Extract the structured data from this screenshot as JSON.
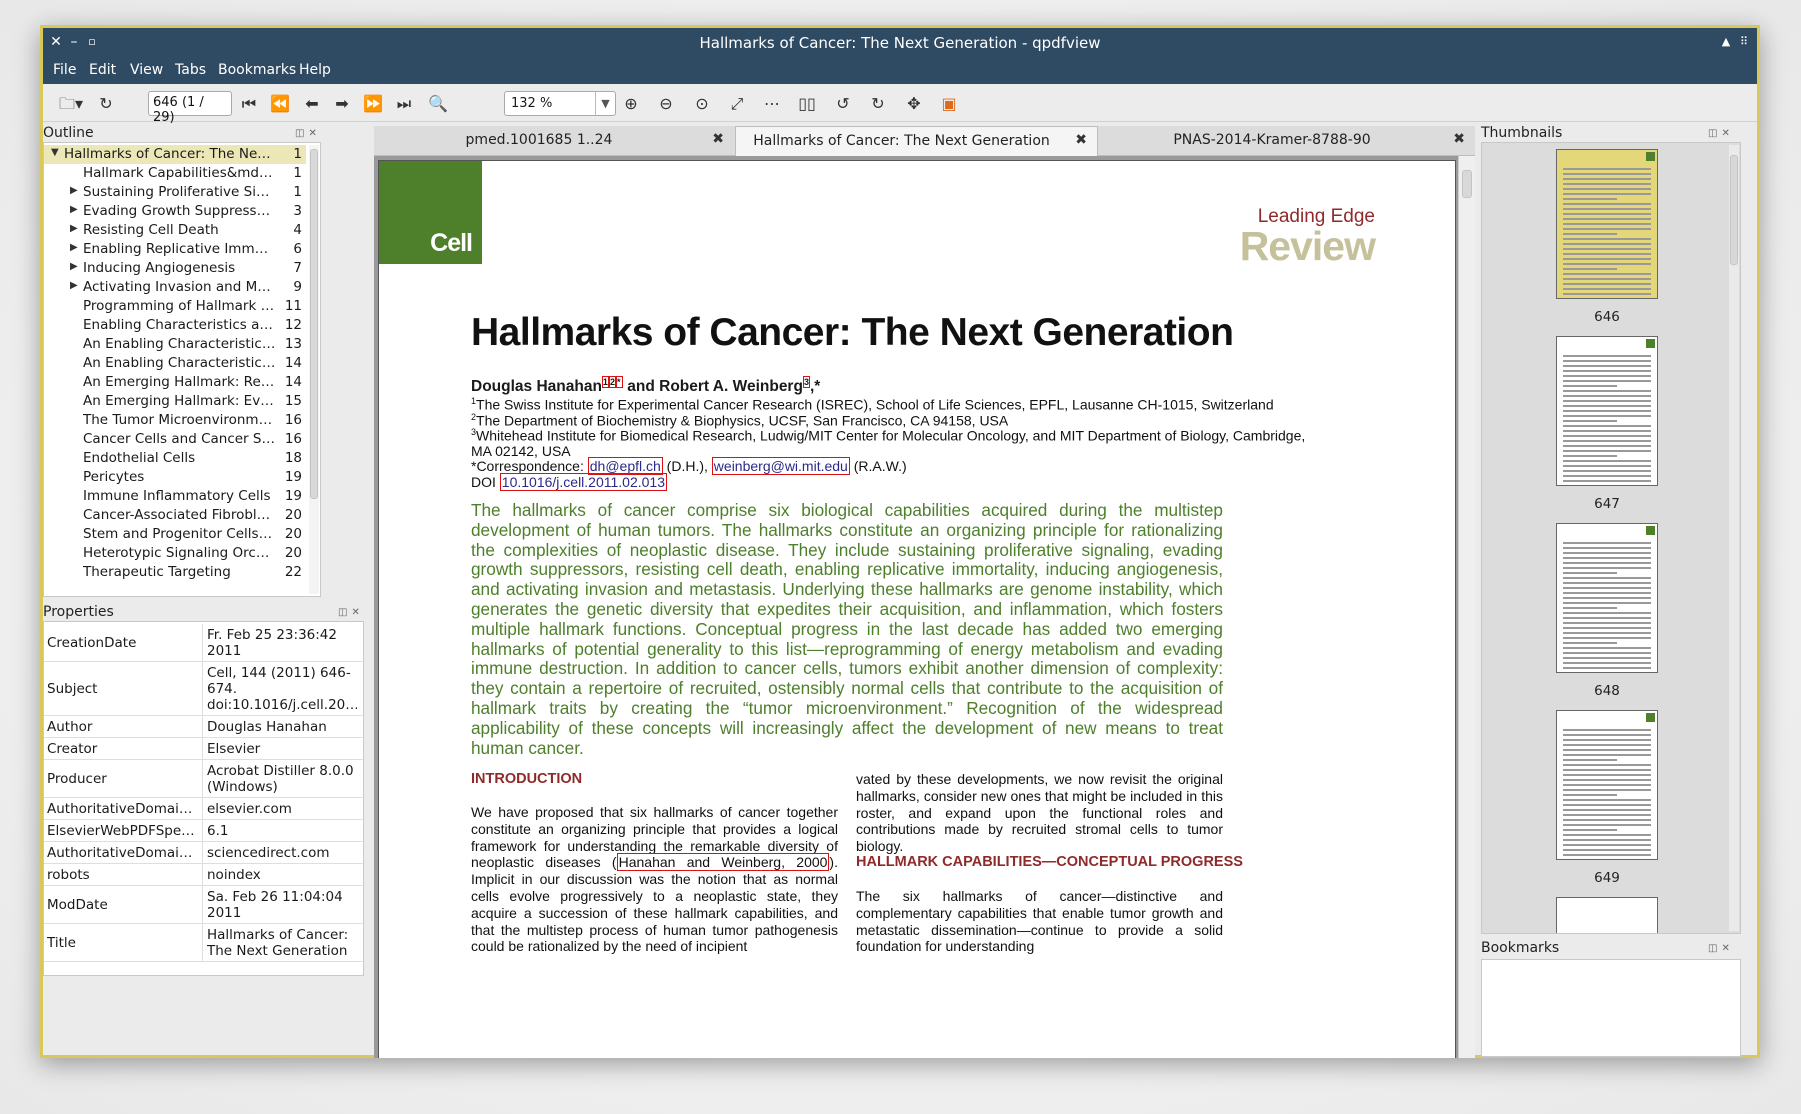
{
  "window": {
    "title": "Hallmarks of Cancer: The Next Generation - qpdfview"
  },
  "menu": [
    "File",
    "Edit",
    "View",
    "Tabs",
    "Bookmarks",
    "Help"
  ],
  "toolbar": {
    "page_field": "646 (1 / 29)",
    "zoom": "132 %"
  },
  "outline": {
    "title": "Outline",
    "items": [
      {
        "label": "Hallmarks of Cancer: The Next Gene…",
        "page": "1",
        "arrow": "▼",
        "indent": 0
      },
      {
        "label": "Hallmark Capabilities&mdash;Co…",
        "page": "1",
        "arrow": "",
        "indent": 1
      },
      {
        "label": "Sustaining Proliferative Signaling",
        "page": "1",
        "arrow": "▶",
        "indent": 1
      },
      {
        "label": "Evading Growth Suppressors",
        "page": "3",
        "arrow": "▶",
        "indent": 1
      },
      {
        "label": "Resisting Cell Death",
        "page": "4",
        "arrow": "▶",
        "indent": 1
      },
      {
        "label": "Enabling Replicative Immortality",
        "page": "6",
        "arrow": "▶",
        "indent": 1
      },
      {
        "label": "Inducing Angiogenesis",
        "page": "7",
        "arrow": "▶",
        "indent": 1
      },
      {
        "label": "Activating Invasion and Metastasis",
        "page": "9",
        "arrow": "▶",
        "indent": 1
      },
      {
        "label": "Programming of Hallmark Capabi…",
        "page": "11",
        "arrow": "",
        "indent": 1
      },
      {
        "label": "Enabling Characteristics and Eme…",
        "page": "12",
        "arrow": "",
        "indent": 1
      },
      {
        "label": "An Enabling Characteristic: Geno…",
        "page": "13",
        "arrow": "",
        "indent": 1
      },
      {
        "label": "An Enabling Characteristic: Tumo…",
        "page": "14",
        "arrow": "",
        "indent": 1
      },
      {
        "label": "An Emerging Hallmark: Reprogra…",
        "page": "14",
        "arrow": "",
        "indent": 1
      },
      {
        "label": "An Emerging Hallmark: Evading I…",
        "page": "15",
        "arrow": "",
        "indent": 1
      },
      {
        "label": "The Tumor Microenvironment",
        "page": "16",
        "arrow": "",
        "indent": 1
      },
      {
        "label": "Cancer Cells and Cancer Stem Cells",
        "page": "16",
        "arrow": "",
        "indent": 1
      },
      {
        "label": "Endothelial Cells",
        "page": "18",
        "arrow": "",
        "indent": 1
      },
      {
        "label": "Pericytes",
        "page": "19",
        "arrow": "",
        "indent": 1
      },
      {
        "label": "Immune Inflammatory Cells",
        "page": "19",
        "arrow": "",
        "indent": 1
      },
      {
        "label": "Cancer-Associated Fibroblasts",
        "page": "20",
        "arrow": "",
        "indent": 1
      },
      {
        "label": "Stem and Progenitor Cells of the …",
        "page": "20",
        "arrow": "",
        "indent": 1
      },
      {
        "label": "Heterotypic Signaling Orchestrat…",
        "page": "20",
        "arrow": "",
        "indent": 1
      },
      {
        "label": "Therapeutic Targeting",
        "page": "22",
        "arrow": "",
        "indent": 1
      }
    ]
  },
  "properties": {
    "title": "Properties",
    "rows": [
      {
        "key": "CreationDate",
        "value": "Fr. Feb 25 23:36:42 2011",
        "lines": 2
      },
      {
        "key": "Subject",
        "value": "Cell, 144 (2011) 646-674. doi:10.1016/j.cell.20…",
        "lines": 3
      },
      {
        "key": "Author",
        "value": "Douglas Hanahan",
        "lines": 1
      },
      {
        "key": "Creator",
        "value": "Elsevier",
        "lines": 1
      },
      {
        "key": "Producer",
        "value": "Acrobat Distiller 8.0.0 (Windows)",
        "lines": 2
      },
      {
        "key": "AuthoritativeDomai…",
        "value": "elsevier.com",
        "lines": 1
      },
      {
        "key": "ElsevierWebPDFSpe…",
        "value": "6.1",
        "lines": 1
      },
      {
        "key": "AuthoritativeDomai…",
        "value": "sciencedirect.com",
        "lines": 1
      },
      {
        "key": "robots",
        "value": "noindex",
        "lines": 1
      },
      {
        "key": "ModDate",
        "value": "Sa. Feb 26 11:04:04 2011",
        "lines": 2
      },
      {
        "key": "Title",
        "value": "Hallmarks of Cancer: The Next Generation",
        "lines": 2
      }
    ]
  },
  "tabs": [
    {
      "label": "pmed.1001685 1..24",
      "active": false
    },
    {
      "label": "Hallmarks of Cancer: The Next Generation",
      "active": true
    },
    {
      "label": "PNAS-2014-Kramer-8788-90",
      "active": false
    }
  ],
  "document": {
    "logo": "Cell",
    "leading_edge": "Leading Edge",
    "review": "Review",
    "title": "Hallmarks of Cancer: The Next Generation",
    "authors_a": "Douglas Hanahan",
    "authors_marks_a": [
      "1",
      "2",
      "*"
    ],
    "authors_mid": " and Robert A. Weinberg",
    "authors_marks_b": [
      "3"
    ],
    "authors_tail": ",*",
    "affiliations": [
      {
        "sup": "1",
        "text": "The Swiss Institute for Experimental Cancer Research (ISREC), School of Life Sciences, EPFL, Lausanne CH-1015, Switzerland"
      },
      {
        "sup": "2",
        "text": "The Department of Biochemistry & Biophysics, UCSF, San Francisco, CA 94158, USA"
      },
      {
        "sup": "3",
        "text": "Whitehead Institute for Biomedical Research, Ludwig/MIT Center for Molecular Oncology, and MIT Department of Biology, Cambridge,"
      },
      {
        "sup": "",
        "text": "MA 02142, USA"
      }
    ],
    "correspondence_label": "*Correspondence: ",
    "email1": "dh@epfl.ch",
    "email1_suffix": " (D.H.), ",
    "email2": "weinberg@wi.mit.edu",
    "email2_suffix": " (R.A.W.)",
    "doi_label": "DOI ",
    "doi": "10.1016/j.cell.2011.02.013",
    "abstract": "The hallmarks of cancer comprise six biological capabilities acquired during the multistep development of human tumors. The hallmarks constitute an organizing principle for rationalizing the complexities of neoplastic disease. They include sustaining proliferative signaling, evading growth suppressors, resisting cell death, enabling replicative immortality, inducing angiogenesis, and activating invasion and metastasis. Underlying these hallmarks are genome instability, which generates the genetic diversity that expedites their acquisition, and inflammation, which fosters multiple hallmark functions. Conceptual progress in the last decade has added two emerging hallmarks of potential generality to this list—reprogramming of energy metabolism and evading immune destruction. In addition to cancer cells, tumors exhibit another dimension of complexity: they contain a repertoire of recruited, ostensibly normal cells that contribute to the acquisition of hallmark traits by creating the “tumor microenvironment.” Recognition of the widespread applicability of these concepts will increasingly affect the development of new means to treat human cancer.",
    "intro_heading": "INTRODUCTION",
    "intro_text_a": "We have proposed that six hallmarks of cancer together constitute an organizing principle that provides a logical framework for understanding the remarkable diversity of neoplastic diseases (",
    "intro_ref": "Hanahan and Weinberg, 2000",
    "intro_text_b": "). Implicit in our discussion was the notion that as normal cells evolve progressively to a neoplastic state, they acquire a succession of these hallmark capabilities, and that the multistep process of human tumor pathogenesis could be rationalized by the need of incipient",
    "right_col_text": "vated by these developments, we now revisit the original hallmarks, consider new ones that might be included in this roster, and expand upon the functional roles and contributions made by recruited stromal cells to tumor biology.",
    "hallmark_heading": "HALLMARK CAPABILITIES—CONCEPTUAL PROGRESS",
    "hallmark_text": "The six hallmarks of cancer—distinctive and complementary capabilities that enable tumor growth and metastatic dissemination—continue to provide a solid foundation for understanding"
  },
  "thumbnails": {
    "title": "Thumbnails",
    "pages": [
      "646",
      "647",
      "648",
      "649"
    ]
  },
  "bookmarks": {
    "title": "Bookmarks"
  },
  "colors": {
    "titlebar": "#2f4a63",
    "accent_yellow": "#d8c95a",
    "cell_green": "#4e7f2b",
    "heading_red": "#8f2a2a",
    "review_tan": "#c5c19a"
  }
}
